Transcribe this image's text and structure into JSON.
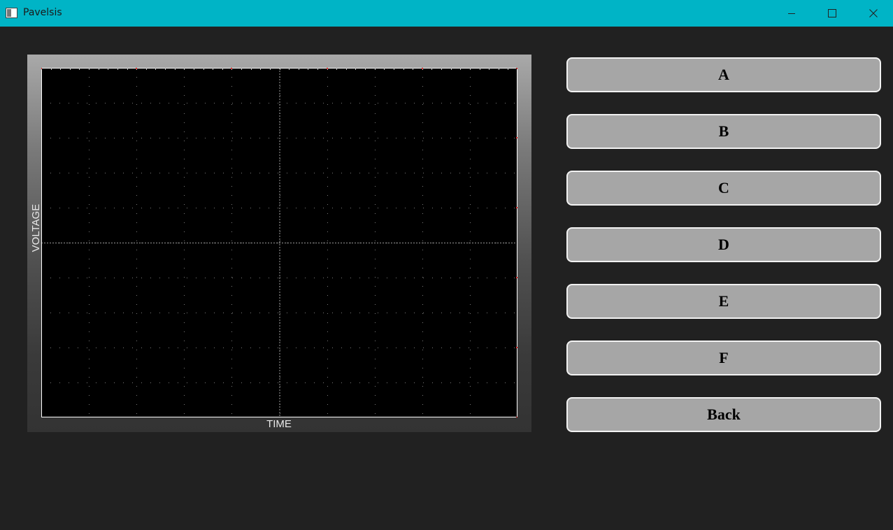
{
  "window": {
    "title": "Pavelsis",
    "controls": [
      "minimize-icon",
      "maximize-icon",
      "close-icon"
    ]
  },
  "scope": {
    "ylabel": "VOLTAGE",
    "xlabel": "TIME"
  },
  "buttons": {
    "a": "A",
    "b": "B",
    "c": "C",
    "d": "D",
    "e": "E",
    "f": "F",
    "back": "Back"
  },
  "colors": {
    "titlebar": "#00b4c6",
    "background": "#212121",
    "button": "#a6a6a6",
    "plot": "#000000"
  }
}
